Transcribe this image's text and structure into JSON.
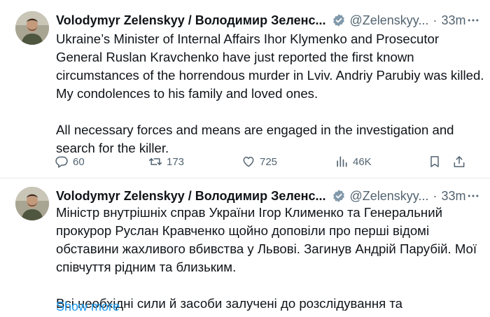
{
  "tweets": [
    {
      "author_name": "Volodymyr Zelenskyy / Володимир Зеленс...",
      "handle": "@Zelenskyy...",
      "separator": "·",
      "time": "33m",
      "paragraphs": [
        "Ukraine’s Minister of Internal Affairs Ihor Klymenko and Prosecutor General Ruslan Kravchenko have just reported the first known circumstances of the horrendous murder in Lviv. Andriy Parubiy was killed. My condolences to his family and loved ones.",
        "All necessary forces and means are engaged in the investigation and search for the killer."
      ],
      "actions": {
        "replies": "60",
        "reposts": "173",
        "likes": "725",
        "views": "46K"
      }
    },
    {
      "author_name": "Volodymyr Zelenskyy / Володимир Зеленс...",
      "handle": "@Zelenskyy...",
      "separator": "·",
      "time": "33m",
      "paragraphs": [
        "Міністр внутрішніх справ України Ігор Клименко та Генеральний прокурор Руслан Кравченко щойно доповіли про перші відомі обставини жахливого вбивства у Львові. Загинув Андрій Парубій. Мої співчуття рідним та близьким.",
        "Всі необхідні сили й засоби залучені до розслідування та"
      ],
      "show_more": "Show more"
    }
  ],
  "icons": {
    "avatar": "avatar-photo",
    "verified": "verified-badge-icon",
    "more": "more-dots-icon",
    "reply": "reply-icon",
    "repost": "repost-icon",
    "like": "heart-icon",
    "views": "views-chart-icon",
    "bookmark": "bookmark-icon",
    "share": "share-icon"
  },
  "colors": {
    "text": "#0f1419",
    "secondary": "#536471",
    "link": "#1d9bf0",
    "divider": "#e6e9eb"
  }
}
